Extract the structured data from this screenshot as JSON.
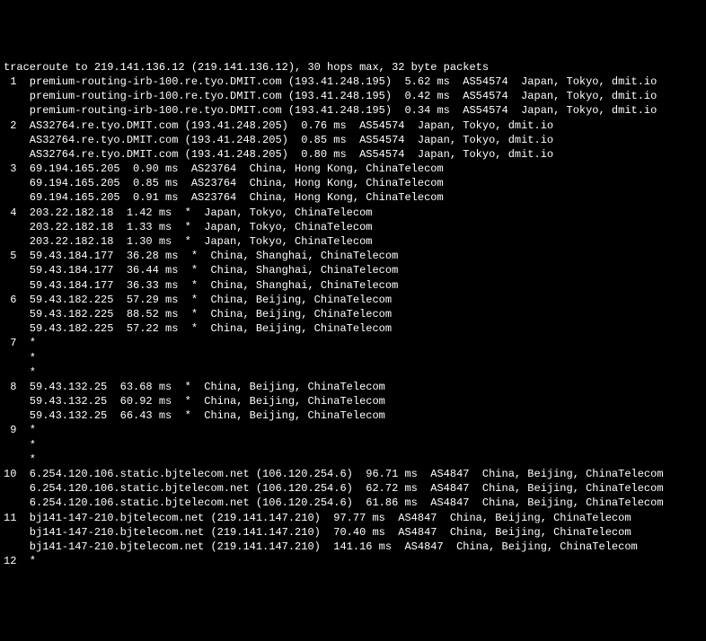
{
  "header": "traceroute to 219.141.136.12 (219.141.136.12), 30 hops max, 32 byte packets",
  "lines": [
    " 1  premium-routing-irb-100.re.tyo.DMIT.com (193.41.248.195)  5.62 ms  AS54574  Japan, Tokyo, dmit.io",
    "    premium-routing-irb-100.re.tyo.DMIT.com (193.41.248.195)  0.42 ms  AS54574  Japan, Tokyo, dmit.io",
    "    premium-routing-irb-100.re.tyo.DMIT.com (193.41.248.195)  0.34 ms  AS54574  Japan, Tokyo, dmit.io",
    " 2  AS32764.re.tyo.DMIT.com (193.41.248.205)  0.76 ms  AS54574  Japan, Tokyo, dmit.io",
    "    AS32764.re.tyo.DMIT.com (193.41.248.205)  0.85 ms  AS54574  Japan, Tokyo, dmit.io",
    "    AS32764.re.tyo.DMIT.com (193.41.248.205)  0.80 ms  AS54574  Japan, Tokyo, dmit.io",
    " 3  69.194.165.205  0.90 ms  AS23764  China, Hong Kong, ChinaTelecom",
    "    69.194.165.205  0.85 ms  AS23764  China, Hong Kong, ChinaTelecom",
    "    69.194.165.205  0.91 ms  AS23764  China, Hong Kong, ChinaTelecom",
    " 4  203.22.182.18  1.42 ms  *  Japan, Tokyo, ChinaTelecom",
    "    203.22.182.18  1.33 ms  *  Japan, Tokyo, ChinaTelecom",
    "    203.22.182.18  1.30 ms  *  Japan, Tokyo, ChinaTelecom",
    " 5  59.43.184.177  36.28 ms  *  China, Shanghai, ChinaTelecom",
    "    59.43.184.177  36.44 ms  *  China, Shanghai, ChinaTelecom",
    "    59.43.184.177  36.33 ms  *  China, Shanghai, ChinaTelecom",
    " 6  59.43.182.225  57.29 ms  *  China, Beijing, ChinaTelecom",
    "    59.43.182.225  88.52 ms  *  China, Beijing, ChinaTelecom",
    "    59.43.182.225  57.22 ms  *  China, Beijing, ChinaTelecom",
    " 7  *",
    "    *",
    "    *",
    " 8  59.43.132.25  63.68 ms  *  China, Beijing, ChinaTelecom",
    "    59.43.132.25  60.92 ms  *  China, Beijing, ChinaTelecom",
    "    59.43.132.25  66.43 ms  *  China, Beijing, ChinaTelecom",
    " 9  *",
    "    *",
    "    *",
    "10  6.254.120.106.static.bjtelecom.net (106.120.254.6)  96.71 ms  AS4847  China, Beijing, ChinaTelecom",
    "    6.254.120.106.static.bjtelecom.net (106.120.254.6)  62.72 ms  AS4847  China, Beijing, ChinaTelecom",
    "    6.254.120.106.static.bjtelecom.net (106.120.254.6)  61.86 ms  AS4847  China, Beijing, ChinaTelecom",
    "11  bj141-147-210.bjtelecom.net (219.141.147.210)  97.77 ms  AS4847  China, Beijing, ChinaTelecom",
    "    bj141-147-210.bjtelecom.net (219.141.147.210)  70.40 ms  AS4847  China, Beijing, ChinaTelecom",
    "    bj141-147-210.bjtelecom.net (219.141.147.210)  141.16 ms  AS4847  China, Beijing, ChinaTelecom",
    "12  *"
  ]
}
